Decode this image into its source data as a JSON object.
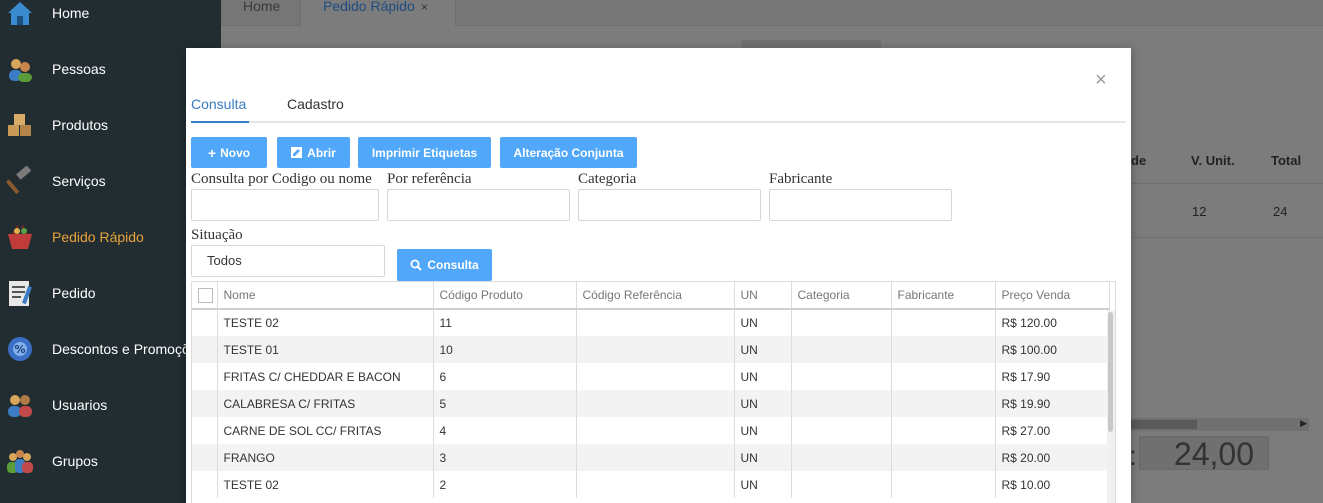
{
  "sidebar": {
    "items": [
      {
        "label": "Home",
        "icon": "home-icon"
      },
      {
        "label": "Pessoas",
        "icon": "people-icon"
      },
      {
        "label": "Produtos",
        "icon": "boxes-icon"
      },
      {
        "label": "Serviços",
        "icon": "hammer-icon"
      },
      {
        "label": "Pedido Rápido",
        "icon": "basket-icon",
        "active": true
      },
      {
        "label": "Pedido",
        "icon": "order-form-icon"
      },
      {
        "label": "Descontos e Promoções",
        "icon": "discount-gear-icon"
      },
      {
        "label": "Usuarios",
        "icon": "users-icon"
      },
      {
        "label": "Grupos",
        "icon": "groups-icon"
      }
    ]
  },
  "tabs": {
    "home": "Home",
    "pedido": "Pedido Rápido",
    "close_glyph": "×"
  },
  "background": {
    "col_qtde_fragment": "de",
    "col_vunit": "V. Unit.",
    "col_total": "Total",
    "row_vunit": "12",
    "row_total": "24",
    "total_value": "24,00",
    "total_colon": ":"
  },
  "modal": {
    "close_glyph": "×",
    "tabs": {
      "consulta": "Consulta",
      "cadastro": "Cadastro"
    },
    "buttons": {
      "novo": "Novo",
      "abrir": "Abrir",
      "imprimir": "Imprimir Etiquetas",
      "alteracao": "Alteração Conjunta",
      "consulta": "Consulta"
    },
    "filters": {
      "codigo_label": "Consulta por Codigo ou nome",
      "codigo_value": "",
      "referencia_label": "Por referência",
      "referencia_value": "",
      "categoria_label": "Categoria",
      "categoria_value": "",
      "fabricante_label": "Fabricante",
      "fabricante_value": "",
      "situacao_label": "Situação",
      "situacao_value": "Todos"
    },
    "table": {
      "headers": [
        "Nome",
        "Código Produto",
        "Código Referência",
        "UN",
        "Categoria",
        "Fabricante",
        "Preço Venda"
      ],
      "rows": [
        {
          "nome": "TESTE 02",
          "codigo": "11",
          "ref": "",
          "un": "UN",
          "cat": "",
          "fab": "",
          "preco": "R$ 120.00"
        },
        {
          "nome": "TESTE 01",
          "codigo": "10",
          "ref": "",
          "un": "UN",
          "cat": "",
          "fab": "",
          "preco": "R$ 100.00"
        },
        {
          "nome": "FRITAS C/ CHEDDAR E BACON",
          "codigo": "6",
          "ref": "",
          "un": "UN",
          "cat": "",
          "fab": "",
          "preco": "R$ 17.90"
        },
        {
          "nome": "CALABRESA C/ FRITAS",
          "codigo": "5",
          "ref": "",
          "un": "UN",
          "cat": "",
          "fab": "",
          "preco": "R$ 19.90"
        },
        {
          "nome": "CARNE DE SOL CC/ FRITAS",
          "codigo": "4",
          "ref": "",
          "un": "UN",
          "cat": "",
          "fab": "",
          "preco": "R$ 27.00"
        },
        {
          "nome": "FRANGO",
          "codigo": "3",
          "ref": "",
          "un": "UN",
          "cat": "",
          "fab": "",
          "preco": "R$ 20.00"
        },
        {
          "nome": "TESTE 02",
          "codigo": "2",
          "ref": "",
          "un": "UN",
          "cat": "",
          "fab": "",
          "preco": "R$ 10.00"
        }
      ]
    }
  },
  "colors": {
    "sidebar_bg": "#222d32",
    "active_menu": "#e8a33a",
    "accent": "#51a7f9",
    "tab_active": "#3a7cc1"
  }
}
